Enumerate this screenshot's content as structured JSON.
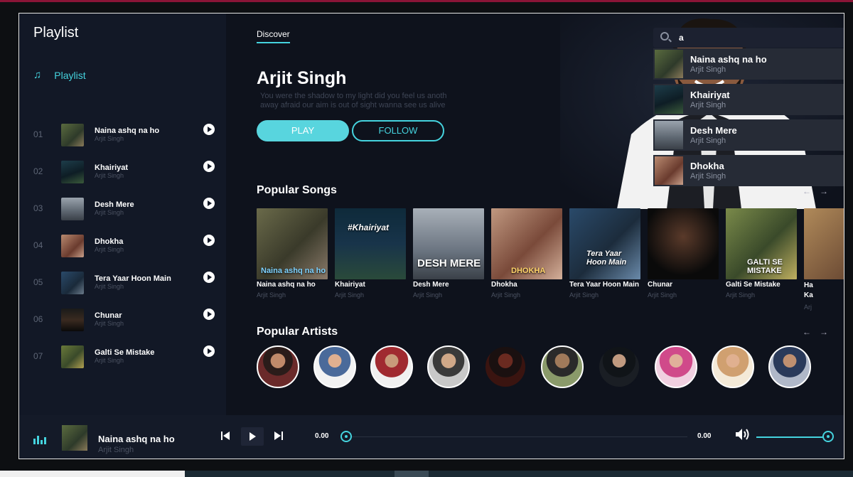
{
  "app": {
    "sidebar_title": "Playlist",
    "nav_playlist": "Playlist",
    "tab_discover": "Discover"
  },
  "colors": {
    "accent": "#45d3de",
    "background": "#10141f",
    "sidebar": "#121826"
  },
  "search": {
    "value": "a",
    "results": [
      {
        "title": "Naina ashq na ho",
        "artist": "Arjit Singh"
      },
      {
        "title": "Khairiyat",
        "artist": "Arjit Singh"
      },
      {
        "title": "Desh Mere",
        "artist": "Arjit Singh"
      },
      {
        "title": "Dhokha",
        "artist": "Arjit Singh"
      }
    ]
  },
  "sidebar": {
    "tracks": [
      {
        "num": "01",
        "title": "Naina ashq na ho",
        "artist": "Arjit Singh"
      },
      {
        "num": "02",
        "title": "Khairiyat",
        "artist": "Arjit Singh"
      },
      {
        "num": "03",
        "title": "Desh Mere",
        "artist": "Arjit Singh"
      },
      {
        "num": "04",
        "title": "Dhokha",
        "artist": "Arjit Singh"
      },
      {
        "num": "05",
        "title": "Tera Yaar Hoon Main",
        "artist": "Arjit Singh"
      },
      {
        "num": "06",
        "title": "Chunar",
        "artist": "Arjit Singh"
      },
      {
        "num": "07",
        "title": "Galti Se Mistake",
        "artist": "Arjit Singh"
      }
    ]
  },
  "hero": {
    "artist_name": "Arjit Singh",
    "description": "You were the shadow to my light did you feel us anoth away afraid our aim is out of sight wanna see us alive",
    "play_label": "PLAY",
    "follow_label": "FOLLOW"
  },
  "popular_songs": {
    "title": "Popular Songs",
    "arrow_prev": "←",
    "arrow_next": "→",
    "items": [
      {
        "title": "Naina ashq na ho",
        "artist": "Arjit Singh",
        "cover_text": "Naina ashq na ho"
      },
      {
        "title": "Khairiyat",
        "artist": "Arjit Singh",
        "cover_text": "#Khairiyat"
      },
      {
        "title": "Desh Mere",
        "artist": "Arjit Singh",
        "cover_text": "DESH MERE"
      },
      {
        "title": "Dhokha",
        "artist": "Arjit Singh",
        "cover_text": "DHOKHA"
      },
      {
        "title": "Tera Yaar Hoon Main",
        "artist": "Arjit Singh",
        "cover_text": "Tera Yaar Hoon Main"
      },
      {
        "title": "Chunar",
        "artist": "Arjit Singh",
        "cover_text": ""
      },
      {
        "title": "Galti Se Mistake",
        "artist": "Arjit Singh",
        "cover_text": "GALTI SE MISTAKE"
      },
      {
        "title": "Ha Ka",
        "artist": "Arj",
        "cover_text": ""
      }
    ]
  },
  "popular_artists": {
    "title": "Popular Artists",
    "arrow_prev": "←",
    "arrow_next": "→"
  },
  "player": {
    "title": "Naina ashq na ho",
    "artist": "Arjit Singh",
    "time_current": "0.00",
    "time_total": "0.00",
    "volume": 1.0
  }
}
